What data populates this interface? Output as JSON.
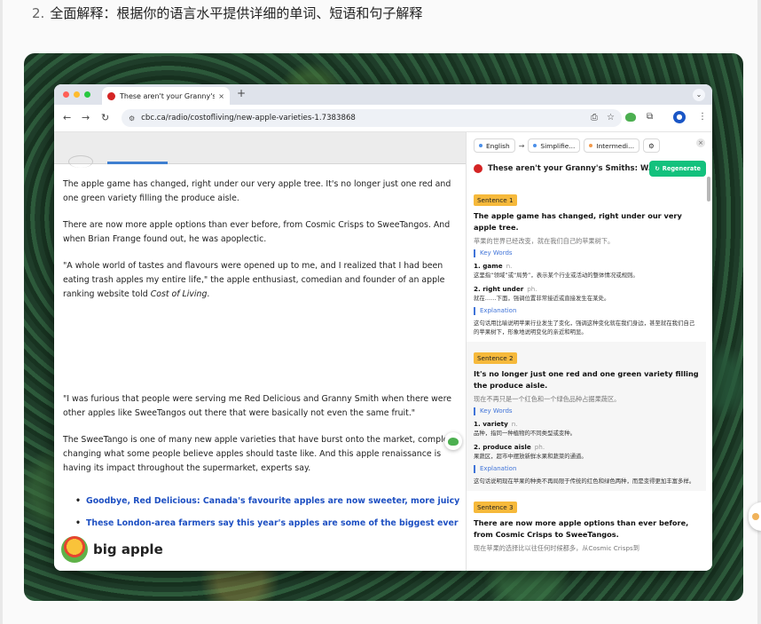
{
  "doc": {
    "number": "2.",
    "heading": "全面解释：根据你的语言水平提供详细的单词、短语和句子解释"
  },
  "browser": {
    "tab_title": "These aren't your Granny's S",
    "tab_close": "×",
    "new_tab": "+",
    "url": "cbc.ca/radio/costofliving/new-apple-varieties-1.7383868",
    "nav": {
      "back": "←",
      "forward": "→",
      "reload": "↻"
    }
  },
  "article": {
    "p1": "The apple game has changed, right under our very apple tree. It's no longer just one red and one green variety filling the produce aisle.",
    "p2": "There are now more apple options than ever before, from Cosmic Crisps to SweeTangos. And when Brian Frange found out, he was apoplectic.",
    "p3": "\"A whole world of tastes and flavours were opened up to me, and I realized that I had been eating trash apples my entire life,\" the apple enthusiast, comedian and founder of an apple ranking website told ",
    "p3_italic": "Cost of Living",
    "p3_end": ".",
    "p4": "\"I was furious that people were serving me Red Delicious and Granny Smith when there were other apples like SweeTangos out there that were basically not even the same fruit.\"",
    "p5": "The SweeTango is one of many new apple varieties that have burst onto the market, completel changing what some people believe apples should taste like. And this apple renaissance is having its impact throughout the supermarket, experts say.",
    "links": [
      "Goodbye, Red Delicious: Canada's favourite apples are now sweeter, more juicy",
      "These London-area farmers say this year's apples are some of the biggest ever"
    ],
    "brand": "big apple"
  },
  "panel": {
    "lang_source": "English",
    "lang_arrow": "→",
    "lang_target": "Simplifie...",
    "level": "Intermedi...",
    "close": "×",
    "title": "These aren't your Granny's Smiths: W...",
    "regenerate": "Regenerate",
    "key_words_label": "Key Words",
    "explanation_label": "Explanation",
    "sentences": [
      {
        "badge": "Sentence 1",
        "en": "The apple game has changed, right under our very apple tree.",
        "zh": "苹果的世界已经改变，就在我们自己的苹果树下。",
        "words": [
          {
            "word": "1. game",
            "pos": "n.",
            "def": "这里指“领域”或“局势”，表示某个行业或活动的整体情况或规则。"
          },
          {
            "word": "2. right under",
            "pos": "ph.",
            "def": "就在……下面，强调位置非常接近或直接发生在某处。"
          }
        ],
        "explanation": "这句话用比喻说明苹果行业发生了变化，强调这种变化就在我们身边，甚至就在我们自己的苹果树下，形象地说明变化的亲近和明显。"
      },
      {
        "badge": "Sentence 2",
        "en": "It's no longer just one red and one green variety filling the produce aisle.",
        "zh": "现在不再只是一个红色和一个绿色品种占据果蔬区。",
        "words": [
          {
            "word": "1. variety",
            "pos": "n.",
            "def": "品种，指同一种植物的不同类型或变种。"
          },
          {
            "word": "2. produce aisle",
            "pos": "ph.",
            "def": "果蔬区，超市中摆放新鲜水果和蔬菜的通道。"
          }
        ],
        "explanation": "这句话说明现在苹果的种类不再局限于传统的红色和绿色两种，而是变得更加丰富多样。"
      },
      {
        "badge": "Sentence 3",
        "en": "There are now more apple options than ever before, from Cosmic Crisps to SweeTangos.",
        "zh": "现在苹果的选择比以往任何时候都多，从Cosmic Crisps到",
        "words": [],
        "explanation": ""
      }
    ]
  }
}
